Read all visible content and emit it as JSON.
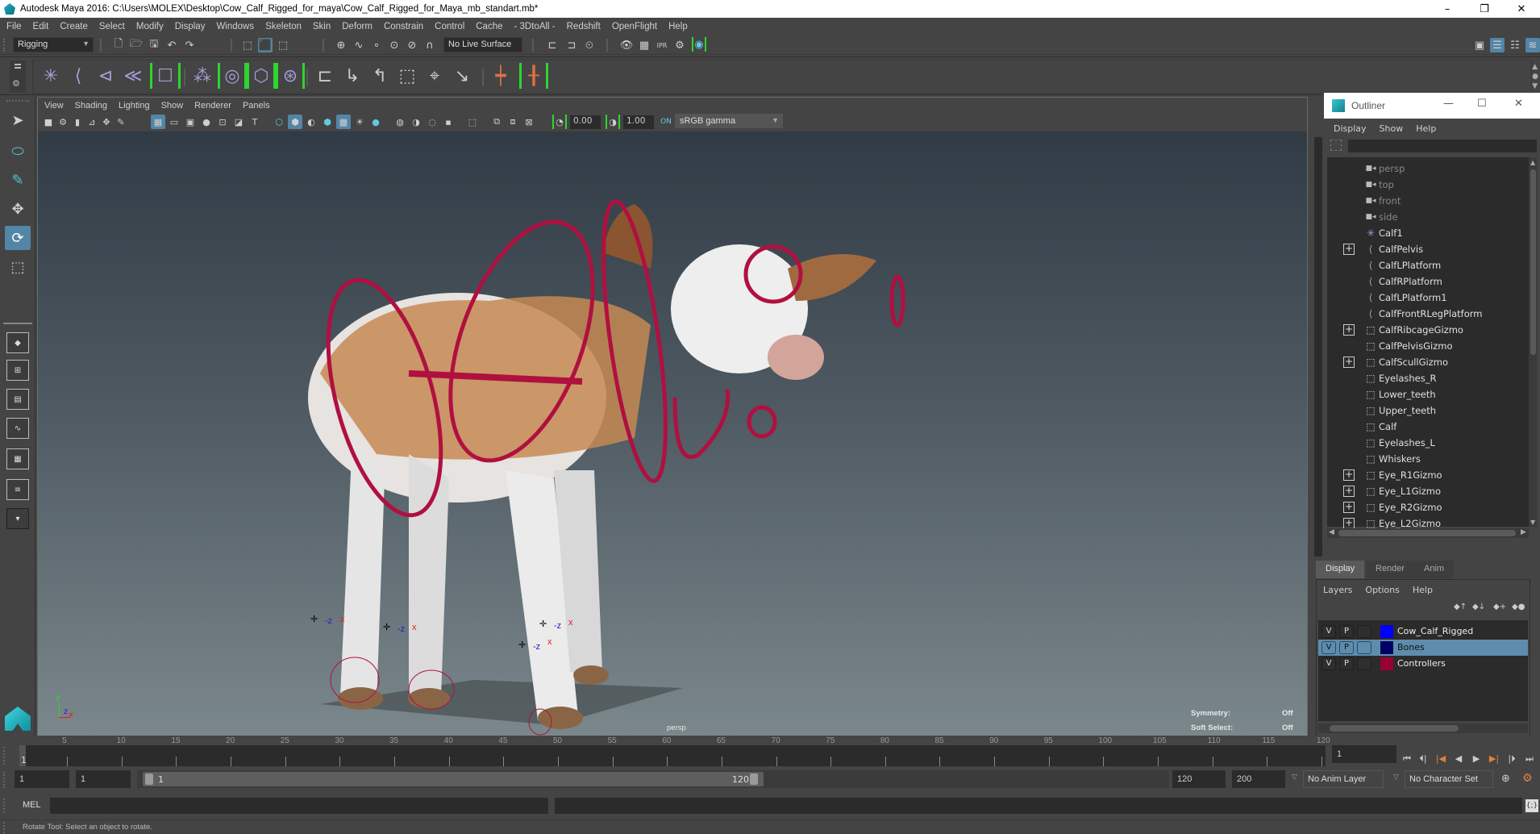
{
  "window": {
    "title": "Autodesk Maya 2016: C:\\Users\\MOLEX\\Desktop\\Cow_Calf_Rigged_for_maya\\Cow_Calf_Rigged_for_Maya_mb_standart.mb*",
    "minimize": "–",
    "restore": "❐",
    "close": "✕"
  },
  "menubar": [
    "File",
    "Edit",
    "Create",
    "Select",
    "Modify",
    "Display",
    "Windows",
    "Skeleton",
    "Skin",
    "Deform",
    "Constrain",
    "Control",
    "Cache",
    "- 3DtoAll -",
    "Redshift",
    "OpenFlight",
    "Help"
  ],
  "statusline": {
    "menuset": "Rigging",
    "live_surface": "No Live Surface"
  },
  "shelf": {
    "icons": [
      "joint-tool",
      "ik-handle",
      "ik-spline",
      "ik-spline-handle",
      "quick-rig",
      "paint-skin-weights",
      "bind-skin",
      "smooth-bind",
      "interactive-bind",
      "parent-constraint",
      "point-constraint",
      "orient-constraint",
      "scale-constraint",
      "aim-constraint",
      "pole-vector-constraint",
      "connect-joint",
      "reroot-skeleton"
    ]
  },
  "viewport": {
    "menu": [
      "View",
      "Shading",
      "Lighting",
      "Show",
      "Renderer",
      "Panels"
    ],
    "exposure": "0.00",
    "gamma": "1.00",
    "color_space": "sRGB gamma",
    "camera_label": "persp",
    "hud": {
      "symmetry_label": "Symmetry:",
      "symmetry_value": "Off",
      "soft_select_label": "Soft Select:",
      "soft_select_value": "Off"
    },
    "axis": {
      "y": "y",
      "z": "z",
      "x": "x"
    }
  },
  "outliner": {
    "title": "Outliner",
    "menu": [
      "Display",
      "Show",
      "Help"
    ],
    "filter_value": "",
    "items": [
      {
        "label": "persp",
        "icon": "camera",
        "expandable": false,
        "dim": true
      },
      {
        "label": "top",
        "icon": "camera",
        "expandable": false,
        "dim": true
      },
      {
        "label": "front",
        "icon": "camera",
        "expandable": false,
        "dim": true
      },
      {
        "label": "side",
        "icon": "camera",
        "expandable": false,
        "dim": true
      },
      {
        "label": "Calf1",
        "icon": "locator",
        "expandable": false,
        "dim": false
      },
      {
        "label": "CalfPelvis",
        "icon": "joint",
        "expandable": true,
        "dim": false
      },
      {
        "label": "CalfLPlatform",
        "icon": "joint",
        "expandable": false,
        "dim": false
      },
      {
        "label": "CalfRPlatform",
        "icon": "joint",
        "expandable": false,
        "dim": false
      },
      {
        "label": "CalfLPlatform1",
        "icon": "joint",
        "expandable": false,
        "dim": false
      },
      {
        "label": "CalfFrontRLegPlatform",
        "icon": "joint",
        "expandable": false,
        "dim": false
      },
      {
        "label": "CalfRibcageGizmo",
        "icon": "mesh",
        "expandable": true,
        "dim": false
      },
      {
        "label": "CalfPelvisGizmo",
        "icon": "mesh",
        "expandable": false,
        "dim": false
      },
      {
        "label": "CalfScullGizmo",
        "icon": "mesh",
        "expandable": true,
        "dim": false
      },
      {
        "label": "Eyelashes_R",
        "icon": "mesh",
        "expandable": false,
        "dim": false
      },
      {
        "label": "Lower_teeth",
        "icon": "mesh",
        "expandable": false,
        "dim": false
      },
      {
        "label": "Upper_teeth",
        "icon": "mesh",
        "expandable": false,
        "dim": false
      },
      {
        "label": "Calf",
        "icon": "mesh",
        "expandable": false,
        "dim": false
      },
      {
        "label": "Eyelashes_L",
        "icon": "mesh",
        "expandable": false,
        "dim": false
      },
      {
        "label": "Whiskers",
        "icon": "mesh",
        "expandable": false,
        "dim": false
      },
      {
        "label": "Eye_R1Gizmo",
        "icon": "mesh",
        "expandable": true,
        "dim": false
      },
      {
        "label": "Eye_L1Gizmo",
        "icon": "mesh",
        "expandable": true,
        "dim": false
      },
      {
        "label": "Eye_R2Gizmo",
        "icon": "mesh",
        "expandable": true,
        "dim": false
      },
      {
        "label": "Eye_L2Gizmo",
        "icon": "mesh",
        "expandable": true,
        "dim": false
      }
    ]
  },
  "layer_editor": {
    "tabs": [
      "Display",
      "Render",
      "Anim"
    ],
    "active_tab": "Display",
    "menu": [
      "Layers",
      "Options",
      "Help"
    ],
    "layers": [
      {
        "name": "Cow_Calf_Rigged",
        "v": "V",
        "p": "P",
        "color": "#0000ff",
        "selected": false
      },
      {
        "name": "Bones",
        "v": "V",
        "p": "P",
        "color": "#000066",
        "selected": true
      },
      {
        "name": "Controllers",
        "v": "V",
        "p": "P",
        "color": "#990033",
        "selected": false
      }
    ]
  },
  "timeline": {
    "current_frame": "1",
    "start": 1,
    "end": 120,
    "tick_labels": [
      "5",
      "10",
      "15",
      "20",
      "25",
      "30",
      "35",
      "40",
      "45",
      "50",
      "55",
      "60",
      "65",
      "70",
      "75",
      "80",
      "85",
      "90",
      "95",
      "100",
      "105",
      "110",
      "115",
      "120"
    ],
    "current_time_field": "1"
  },
  "range": {
    "start_time": "1",
    "playback_start": "1",
    "slider_start": "1",
    "slider_end": "120",
    "playback_end": "120",
    "end_time": "200",
    "anim_layer": "No Anim Layer",
    "character_set": "No Character Set"
  },
  "command_line": {
    "label": "MEL",
    "value": ""
  },
  "help_line": "Rotate Tool: Select an object to rotate.",
  "colors": {
    "accent": "#5285a6",
    "controller_red": "#b01040",
    "shelf_bracket": "#2fd42f"
  }
}
